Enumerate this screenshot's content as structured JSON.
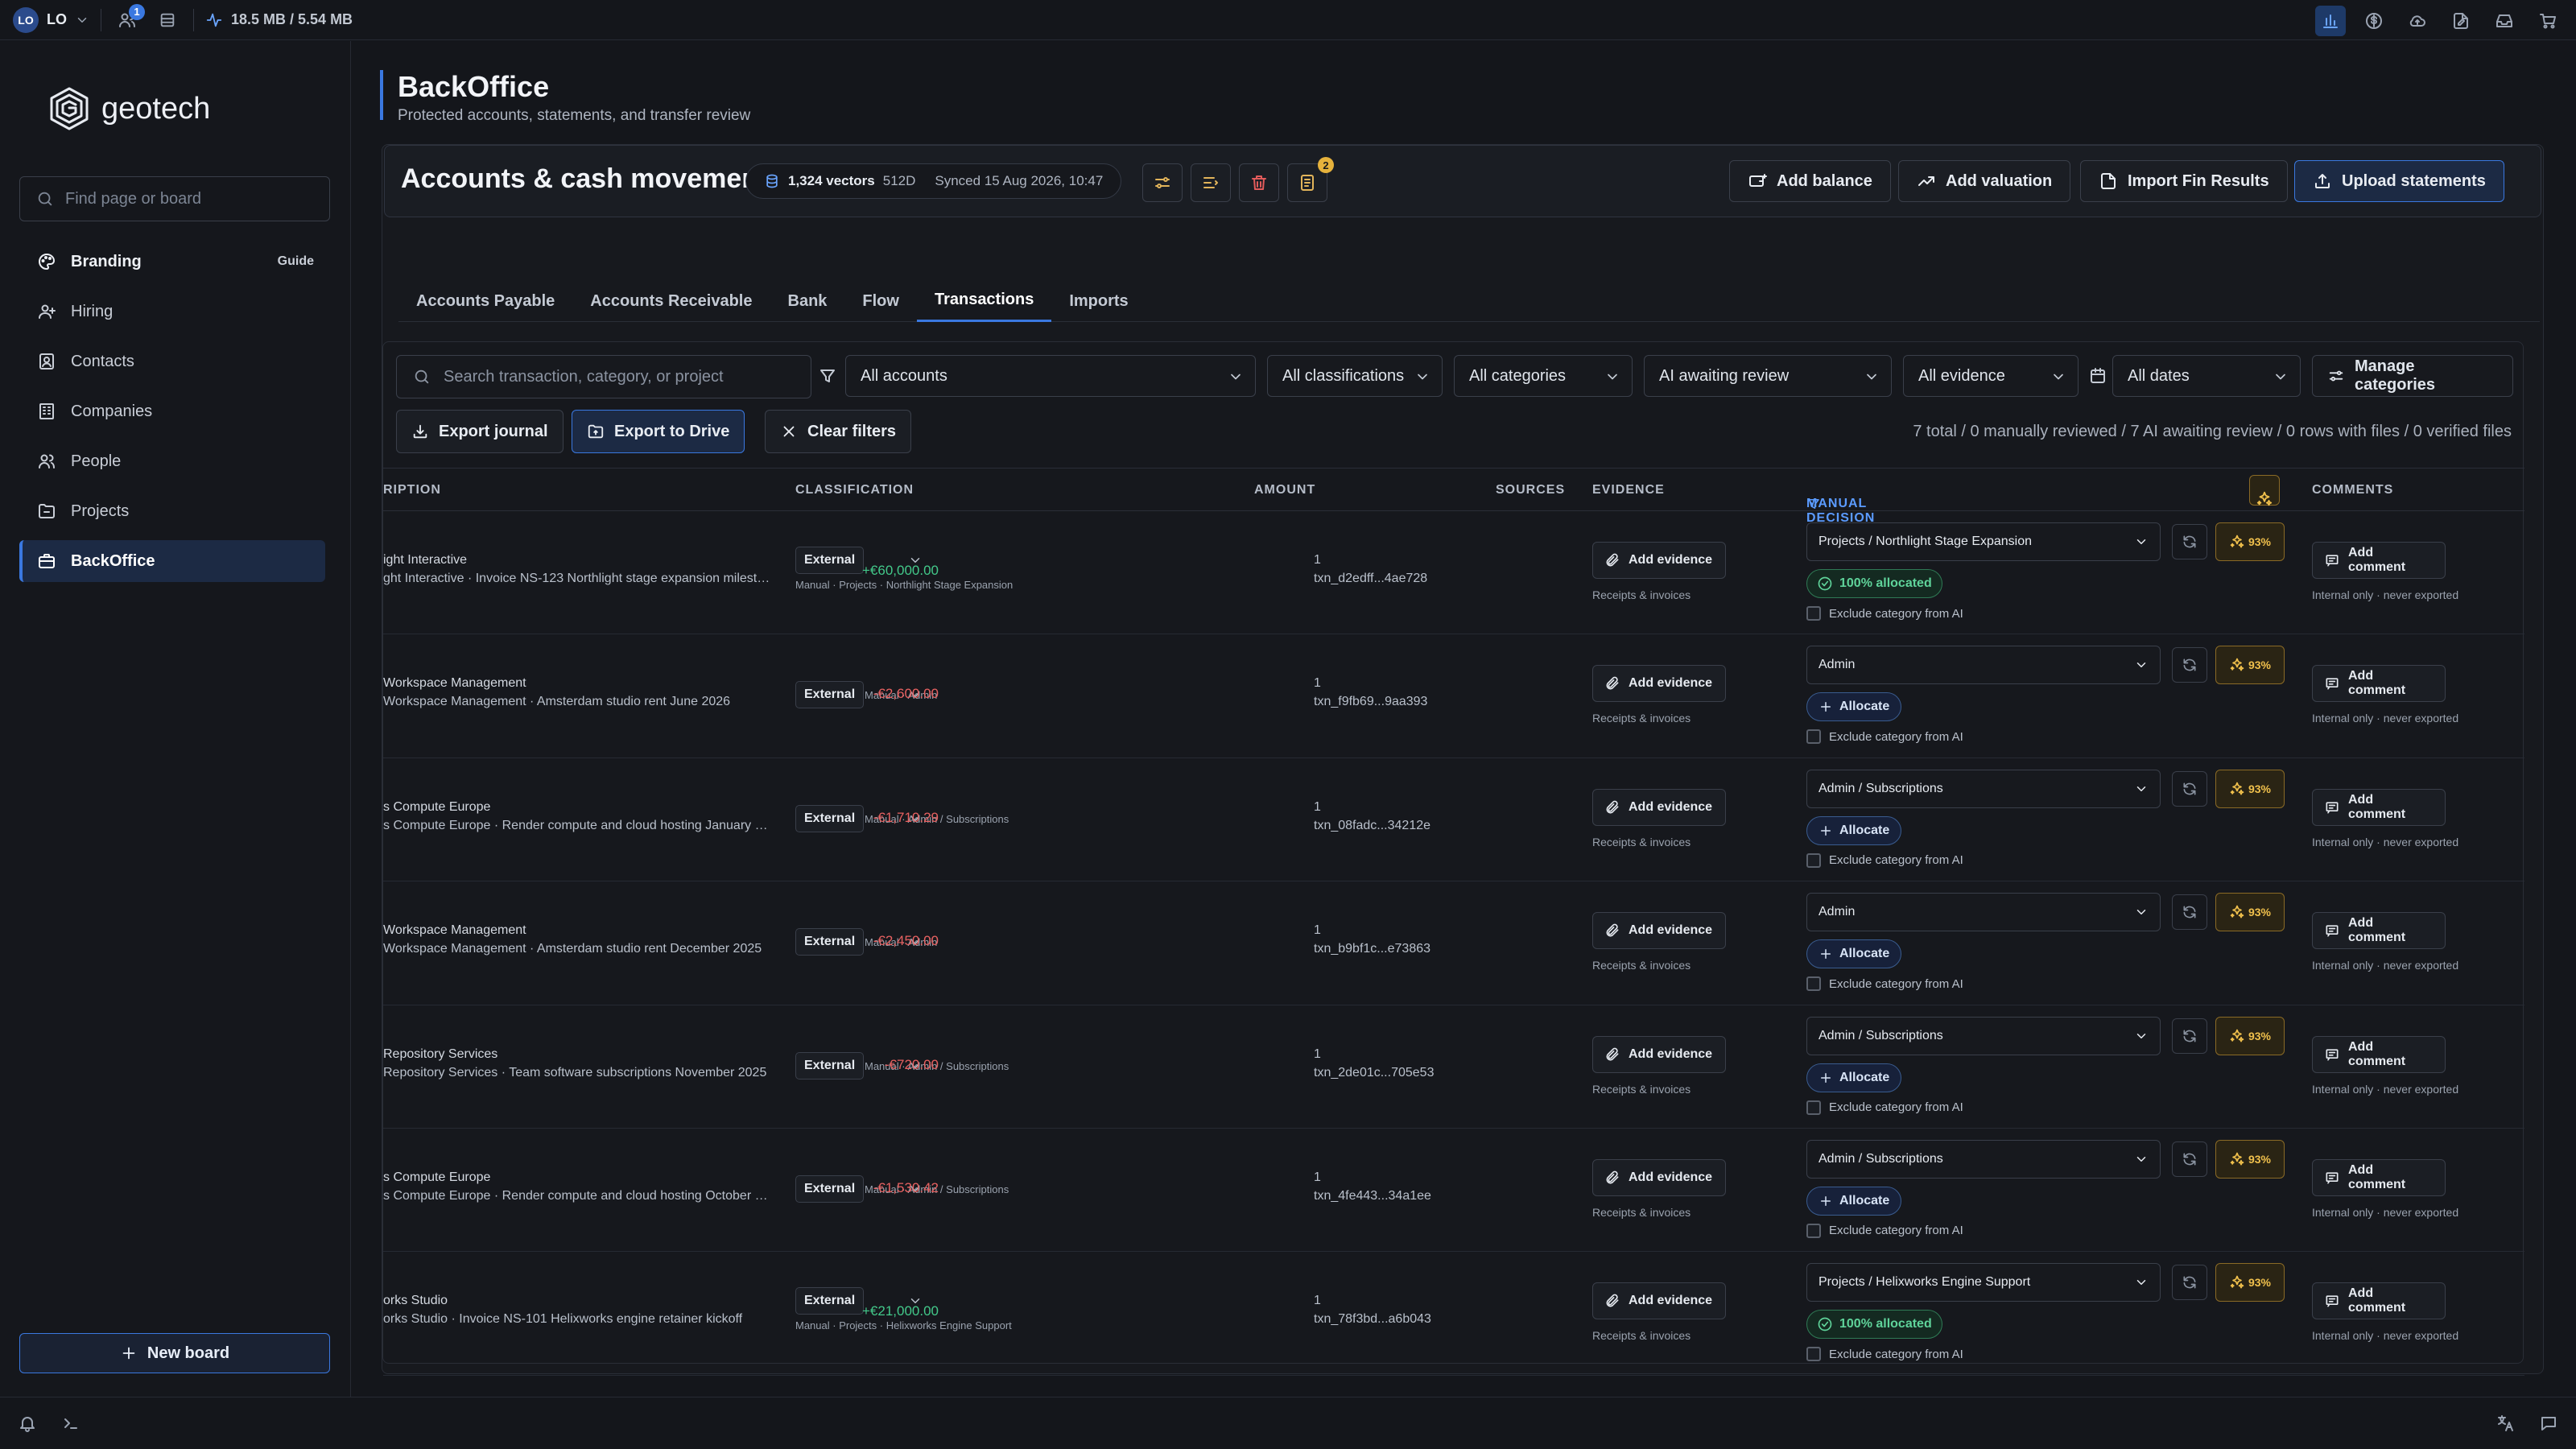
{
  "topbar": {
    "workspace_initials": "LO",
    "workspace_label": "LO",
    "notif_count": "1",
    "memory": "18.5 MB / 5.54 MB"
  },
  "sidebar": {
    "brand": "geotech",
    "search_placeholder": "Find page or board",
    "items": [
      {
        "label": "Branding",
        "extra": "Guide"
      },
      {
        "label": "Hiring"
      },
      {
        "label": "Contacts"
      },
      {
        "label": "Companies"
      },
      {
        "label": "People"
      },
      {
        "label": "Projects"
      },
      {
        "label": "BackOffice"
      }
    ],
    "new_board": "New board"
  },
  "page": {
    "title": "BackOffice",
    "subtitle": "Protected accounts, statements, and transfer review"
  },
  "accounts": {
    "title": "Accounts & cash movement",
    "vectors": "1,324 vectors",
    "dims": "512D",
    "synced": "Synced 15 Aug 2026, 10:47",
    "badge_count": "2",
    "actions": [
      "Add balance",
      "Add valuation",
      "Import Fin Results",
      "Upload statements"
    ]
  },
  "tabs": [
    "Accounts Payable",
    "Accounts Receivable",
    "Bank",
    "Flow",
    "Transactions",
    "Imports"
  ],
  "filters": {
    "search_placeholder": "Search transaction, category, or project",
    "accounts": "All accounts",
    "classifications": "All classifications",
    "categories": "All categories",
    "ai": "AI awaiting review",
    "evidence": "All evidence",
    "dates": "All dates",
    "manage": "Manage categories",
    "export_journal": "Export journal",
    "export_drive": "Export to Drive",
    "clear": "Clear filters",
    "summary": "7 total / 0 manually reviewed / 7 AI awaiting review / 0 rows with files / 0 verified files"
  },
  "columns": {
    "description": "RIPTION",
    "classification": "CLASSIFICATION",
    "amount": "AMOUNT",
    "sources": "SOURCES",
    "evidence": "EVIDENCE",
    "manual": "MANUAL DECISION",
    "comments": "COMMENTS"
  },
  "labels": {
    "add_evidence": "Add evidence",
    "evidence_note": "Receipts & invoices",
    "add_comment": "Add comment",
    "comment_note": "Internal only · never exported",
    "exclude": "Exclude category from AI",
    "allocate": "Allocate",
    "allocated": "100% allocated",
    "ai_conf": "93%"
  },
  "rows": [
    {
      "d1": "ight Interactive",
      "d2": "ght Interactive · Invoice NS-123 Northlight stage expansion milesto...",
      "cls": "External",
      "path": "Manual · Projects · Northlight Stage Expansion",
      "path_below": true,
      "amount": "+€60,000.00",
      "sign": "pos",
      "src": "1",
      "txn": "txn_d2edff...4ae728",
      "decision": "Projects / Northlight Stage Expansion",
      "allocated": true
    },
    {
      "d1": "Workspace Management",
      "d2": "Workspace Management · Amsterdam studio rent June 2026",
      "cls": "External",
      "path": "Manual · Admin",
      "path_below": false,
      "amount": "-€2,600.00",
      "sign": "neg",
      "src": "1",
      "txn": "txn_f9fb69...9aa393",
      "decision": "Admin",
      "allocated": false
    },
    {
      "d1": "s Compute Europe",
      "d2": "s Compute Europe · Render compute and cloud hosting January 20...",
      "cls": "External",
      "path": "Manual · Admin / Subscriptions",
      "path_below": false,
      "amount": "-€1,710.29",
      "sign": "neg",
      "src": "1",
      "txn": "txn_08fadc...34212e",
      "decision": "Admin / Subscriptions",
      "allocated": false
    },
    {
      "d1": "Workspace Management",
      "d2": "Workspace Management · Amsterdam studio rent December 2025",
      "cls": "External",
      "path": "Manual · Admin",
      "path_below": false,
      "amount": "-€2,450.00",
      "sign": "neg",
      "src": "1",
      "txn": "txn_b9bf1c...e73863",
      "decision": "Admin",
      "allocated": false
    },
    {
      "d1": "Repository Services",
      "d2": "Repository Services · Team software subscriptions November 2025",
      "cls": "External",
      "path": "Manual · Admin / Subscriptions",
      "path_below": false,
      "amount": "-€720.00",
      "sign": "neg",
      "src": "1",
      "txn": "txn_2de01c...705e53",
      "decision": "Admin / Subscriptions",
      "allocated": false
    },
    {
      "d1": "s Compute Europe",
      "d2": "s Compute Europe · Render compute and cloud hosting October 20...",
      "cls": "External",
      "path": "Manual · Admin / Subscriptions",
      "path_below": false,
      "amount": "-€1,530.42",
      "sign": "neg",
      "src": "1",
      "txn": "txn_4fe443...34a1ee",
      "decision": "Admin / Subscriptions",
      "allocated": false
    },
    {
      "d1": "orks Studio",
      "d2": "orks Studio · Invoice NS-101 Helixworks engine retainer kickoff",
      "cls": "External",
      "path": "Manual · Projects · Helixworks Engine Support",
      "path_below": true,
      "amount": "+€21,000.00",
      "sign": "pos",
      "src": "1",
      "txn": "txn_78f3bd...a6b043",
      "decision": "Projects / Helixworks Engine Support",
      "allocated": true
    }
  ]
}
